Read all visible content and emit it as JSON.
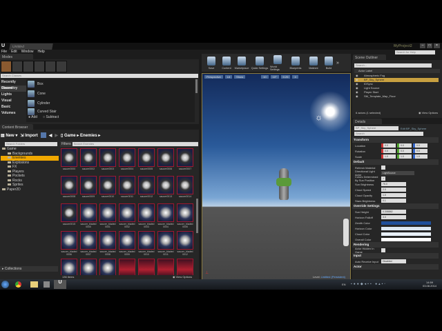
{
  "window": {
    "tab": "Untitled",
    "project": "MyProject2",
    "search_placeholder": "Search for Help"
  },
  "menu": [
    "File",
    "Edit",
    "Window",
    "Help"
  ],
  "modes": {
    "tab": "Modes",
    "search_placeholder": "Search Classes",
    "categories": [
      "Recently Placed",
      "Geometry",
      "Lights",
      "Visual",
      "Basic",
      "Volumes"
    ],
    "selected_category": "Geometry",
    "items": [
      "Box",
      "Cone",
      "Cylinder",
      "Curved Stair"
    ],
    "add": "Add",
    "subtract": "Subtract"
  },
  "content_browser": {
    "tab": "Content Browser",
    "new": "New",
    "import": "Import",
    "path": [
      "Game",
      "Enemies"
    ],
    "folder_search": "Search Folders",
    "filters": "Filters",
    "asset_search": "Search Enemies",
    "folders": [
      {
        "label": "Game",
        "depth": 0
      },
      {
        "label": "Backgrounds",
        "depth": 1
      },
      {
        "label": "Enemies",
        "depth": 1,
        "selected": true
      },
      {
        "label": "Explosions",
        "depth": 1
      },
      {
        "label": "FX",
        "depth": 1
      },
      {
        "label": "Players",
        "depth": 1
      },
      {
        "label": "Pockets",
        "depth": 1
      },
      {
        "label": "Rocks",
        "depth": 1
      },
      {
        "label": "Sprites",
        "depth": 1
      },
      {
        "label": "Paper2D",
        "depth": 0
      }
    ],
    "collections": "Collections",
    "assets": [
      {
        "name": "saucer0000",
        "kind": "gear"
      },
      {
        "name": "saucer0002",
        "kind": "gear"
      },
      {
        "name": "saucer0003",
        "kind": "gear"
      },
      {
        "name": "saucer0004",
        "kind": "gear"
      },
      {
        "name": "saucer0005",
        "kind": "gear"
      },
      {
        "name": "saucer0006",
        "kind": "gear"
      },
      {
        "name": "saucer0007",
        "kind": "gear"
      },
      {
        "name": "saucer0008",
        "kind": "gear"
      },
      {
        "name": "saucer0009",
        "kind": "gear"
      },
      {
        "name": "saucer0010",
        "kind": "gear"
      },
      {
        "name": "saucer0011",
        "kind": "gear"
      },
      {
        "name": "saucer0012",
        "kind": "gear"
      },
      {
        "name": "saucer0013",
        "kind": "gear"
      },
      {
        "name": "saucer0014",
        "kind": "gear"
      },
      {
        "name": "saucer0015",
        "kind": "gear"
      },
      {
        "name": "saucer_bladed0000",
        "kind": "blade"
      },
      {
        "name": "saucer_bladed0001",
        "kind": "blade"
      },
      {
        "name": "saucer_bladed0002",
        "kind": "blade"
      },
      {
        "name": "saucer_bladed0003",
        "kind": "blade"
      },
      {
        "name": "saucer_bladed0004",
        "kind": "blade"
      },
      {
        "name": "saucer_bladed0005",
        "kind": "blade"
      },
      {
        "name": "saucer_bladed0006",
        "kind": "blade"
      },
      {
        "name": "saucer_bladed0007",
        "kind": "blade"
      },
      {
        "name": "saucer_bladed0008",
        "kind": "blade"
      },
      {
        "name": "saucer_bladed0009",
        "kind": "blade"
      },
      {
        "name": "saucer_bladed0010",
        "kind": "blade"
      },
      {
        "name": "saucer_bladed0011",
        "kind": "blade"
      },
      {
        "name": "saucer_bladed0012",
        "kind": "blade"
      },
      {
        "name": "",
        "kind": "blade"
      },
      {
        "name": "",
        "kind": "blade"
      },
      {
        "name": "",
        "kind": "blade"
      },
      {
        "name": "",
        "kind": "red"
      },
      {
        "name": "",
        "kind": "red"
      },
      {
        "name": "",
        "kind": "red"
      },
      {
        "name": "",
        "kind": "red"
      }
    ],
    "count": "136 items",
    "view_options": "View Options"
  },
  "toolbar": [
    "Save",
    "Content",
    "Marketplace",
    "Quick Settings",
    "World Settings",
    "Blueprints",
    "Matinee",
    "Build"
  ],
  "viewport": {
    "perspective": "Perspective",
    "lit": "Lit",
    "show": "Show",
    "grid_snap": "10",
    "rot_snap": "10°",
    "scale_snap": "0.25",
    "camera_speed": "4",
    "level": "Level:",
    "level_name": "Untitled (Persistent)"
  },
  "outliner": {
    "tab": "Scene Outliner",
    "search_placeholder": "Search...",
    "column": "Actor Label",
    "actors": [
      "Atmospheric Fog",
      "BP_Sky_Sphere",
      "IDSync",
      "Light Source",
      "Player Start",
      "SM_Template_Map_Floor"
    ],
    "selected": "BP_Sky_Sphere",
    "status": "6 actors (1 selected)",
    "view_options": "View Options"
  },
  "details": {
    "tab": "Details",
    "name": "BP_Sky_Sphere",
    "edit_link": "Edit BP_Sky_Sphere",
    "search_placeholder": "Search",
    "transform": {
      "title": "Transform",
      "rows": [
        {
          "label": "Location",
          "x": "0.0",
          "y": "0.0",
          "z": "0.0"
        },
        {
          "label": "Rotation",
          "x": "0.0",
          "y": "0.0",
          "z": "0.0"
        },
        {
          "label": "Scale",
          "x": "1.0",
          "y": "1.0",
          "z": "1.0"
        }
      ]
    },
    "default": {
      "title": "Default",
      "refresh_material": "Refresh Material",
      "dir_light_label": "Directional Light Actor",
      "dir_light_value": "LightSource",
      "colors_by_sun": "Colors Determined By Sun Position",
      "fields": [
        {
          "label": "Sun Brightness",
          "value": "75.0"
        },
        {
          "label": "Cloud Speed",
          "value": "2.0"
        },
        {
          "label": "Cloud Opacity",
          "value": "1.0"
        },
        {
          "label": "Stars Brightness",
          "value": "0.1"
        }
      ]
    },
    "override": {
      "title": "Override Settings",
      "fields": [
        {
          "label": "Sun Height",
          "value": "0.308862"
        },
        {
          "label": "Horizon Falloff",
          "value": "3.0"
        }
      ],
      "colors": [
        {
          "label": "Zenith Color",
          "color": "#1f4f9a"
        },
        {
          "label": "Horizon Color",
          "color": "#dde8f2"
        },
        {
          "label": "Cloud Color",
          "color": "#e8f0f8"
        },
        {
          "label": "Overall Color",
          "color": "#ffffff"
        }
      ]
    },
    "rendering": {
      "title": "Rendering",
      "hidden": "Actor Hidden In Game"
    },
    "input": {
      "title": "Input",
      "auto_label": "Auto Receive Input",
      "auto_value": "Disabled"
    },
    "actor": {
      "title": "Actor"
    }
  },
  "taskbar": {
    "lang": "EN",
    "time": "14:59",
    "date": "03.08.2014"
  },
  "colors": {
    "accent": "#f0a800",
    "selection": "#c8a040",
    "panel": "#262626"
  }
}
